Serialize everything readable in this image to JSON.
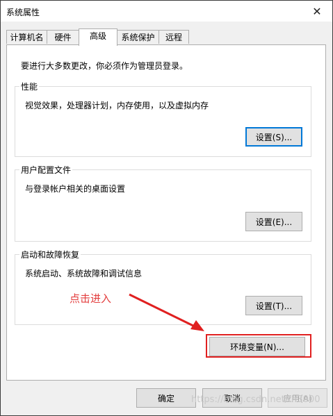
{
  "window": {
    "title": "系统属性",
    "close_glyph": "✕"
  },
  "tabs": [
    {
      "label": "计算机名"
    },
    {
      "label": "硬件"
    },
    {
      "label": "高级"
    },
    {
      "label": "系统保护"
    },
    {
      "label": "远程"
    }
  ],
  "advanced": {
    "intro": "要进行大多数更改，你必须作为管理员登录。",
    "performance": {
      "title": "性能",
      "desc": "视觉效果，处理器计划，内存使用，以及虚拟内存",
      "button": "设置(S)..."
    },
    "user_profiles": {
      "title": "用户配置文件",
      "desc": "与登录帐户相关的桌面设置",
      "button": "设置(E)..."
    },
    "startup_recovery": {
      "title": "启动和故障恢复",
      "desc": "系统启动、系统故障和调试信息",
      "button": "设置(T)..."
    },
    "env_button": "环境变量(N)..."
  },
  "footer": {
    "ok": "确定",
    "cancel": "取消",
    "apply": "应用(A)"
  },
  "annotation": {
    "text": "点击进入",
    "color": "#e33d3d"
  },
  "watermark": "https://blog.csdn.net/th3000"
}
